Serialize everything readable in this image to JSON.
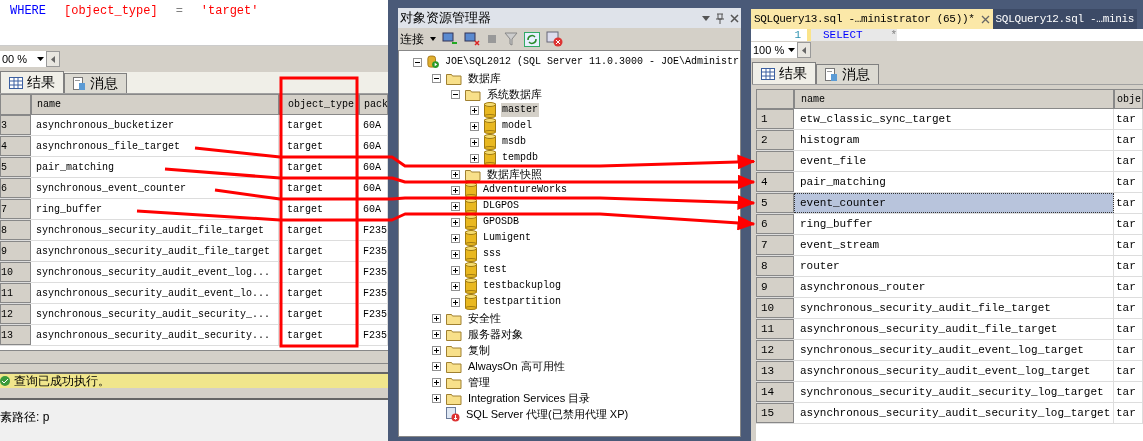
{
  "left_pane": {
    "sql_tokens": [
      {
        "kind": "keyword",
        "text": "WHERE"
      },
      {
        "kind": "identifier",
        "text": "[object_type]"
      },
      {
        "kind": "operator",
        "text": "="
      },
      {
        "kind": "string",
        "text": "'target'"
      }
    ],
    "zoom": "00 %",
    "result_tabs": [
      {
        "label": "结果",
        "selected": true
      },
      {
        "label": "消息",
        "selected": false
      }
    ],
    "columns": [
      "name",
      "object_type",
      "pack"
    ],
    "rows": [
      {
        "num": "3",
        "cells": [
          "asynchronous_bucketizer",
          "target",
          "60A"
        ]
      },
      {
        "num": "4",
        "cells": [
          "asynchronous_file_target",
          "target",
          "60A"
        ]
      },
      {
        "num": "5",
        "cells": [
          "pair_matching",
          "target",
          "60A"
        ]
      },
      {
        "num": "6",
        "cells": [
          "synchronous_event_counter",
          "target",
          "60A"
        ]
      },
      {
        "num": "7",
        "cells": [
          "ring_buffer",
          "target",
          "60A"
        ]
      },
      {
        "num": "8",
        "cells": [
          "synchronous_security_audit_file_target",
          "target",
          "F235"
        ]
      },
      {
        "num": "9",
        "cells": [
          "asynchronous_security_audit_file_target",
          "target",
          "F235"
        ]
      },
      {
        "num": "10",
        "cells": [
          "synchronous_security_audit_event_log...",
          "target",
          "F235"
        ]
      },
      {
        "num": "11",
        "cells": [
          "asynchronous_security_audit_event_lo...",
          "target",
          "F235"
        ]
      },
      {
        "num": "12",
        "cells": [
          "synchronous_security_audit_security_...",
          "target",
          "F235"
        ]
      },
      {
        "num": "13",
        "cells": [
          "asynchronous_security_audit_security...",
          "target",
          "F235"
        ]
      }
    ],
    "status": "查询已成功执行。",
    "path": "素路径: p"
  },
  "object_explorer": {
    "title": "对象资源管理器",
    "connect": "连接",
    "tree": [
      {
        "kind": "server",
        "label": "JOE\\SQL2012 (SQL Server 11.0.3000 - JOE\\Administr",
        "expanded": true,
        "selected": false,
        "children": [
          {
            "kind": "folder",
            "label": "数据库",
            "expanded": true,
            "selected": false,
            "children": [
              {
                "kind": "folder",
                "label": "系统数据库",
                "expanded": true,
                "selected": false,
                "children": [
                  {
                    "kind": "db",
                    "label": "master",
                    "selected": true
                  },
                  {
                    "kind": "db",
                    "label": "model",
                    "selected": false
                  },
                  {
                    "kind": "db",
                    "label": "msdb",
                    "selected": false
                  },
                  {
                    "kind": "db",
                    "label": "tempdb",
                    "selected": false
                  }
                ]
              },
              {
                "kind": "folder",
                "label": "数据库快照",
                "selected": false
              },
              {
                "kind": "db",
                "label": "AdventureWorks",
                "selected": false
              },
              {
                "kind": "db",
                "label": "DLGPOS",
                "selected": false
              },
              {
                "kind": "db",
                "label": "GPOSDB",
                "selected": false
              },
              {
                "kind": "db",
                "label": "Lumigent",
                "selected": false
              },
              {
                "kind": "db",
                "label": "sss",
                "selected": false
              },
              {
                "kind": "db",
                "label": "test",
                "selected": false
              },
              {
                "kind": "db",
                "label": "testbackuplog",
                "selected": false
              },
              {
                "kind": "db",
                "label": "testpartition",
                "selected": false
              }
            ]
          },
          {
            "kind": "folder",
            "label": "安全性",
            "selected": false
          },
          {
            "kind": "folder",
            "label": "服务器对象",
            "selected": false
          },
          {
            "kind": "folder",
            "label": "复制",
            "selected": false
          },
          {
            "kind": "folder",
            "label": "AlwaysOn 高可用性",
            "selected": false
          },
          {
            "kind": "folder",
            "label": "管理",
            "selected": false
          },
          {
            "kind": "folder",
            "label": "Integration Services 目录",
            "selected": false
          },
          {
            "kind": "agent",
            "label": "SQL Server 代理(已禁用代理 XP)",
            "selected": false
          }
        ]
      }
    ]
  },
  "right_pane": {
    "doc_tabs": [
      {
        "label": "SQLQuery13.sql -…ministrator (65))*",
        "selected": true
      },
      {
        "label": "SQLQuery12.sql -…minis",
        "selected": false
      }
    ],
    "line_number": "1",
    "sql_tokens": [
      {
        "kind": "keyword",
        "text": "SELECT"
      },
      {
        "kind": "operator",
        "text": "*"
      }
    ],
    "zoom": "100 %",
    "result_tabs": [
      {
        "label": "结果",
        "selected": true
      },
      {
        "label": "消息",
        "selected": false
      }
    ],
    "columns": [
      "name",
      "obje"
    ],
    "rows": [
      {
        "num": "1",
        "cells": [
          "etw_classic_sync_target",
          "tar"
        ],
        "selected": false
      },
      {
        "num": "2",
        "cells": [
          "histogram",
          "tar"
        ],
        "selected": false
      },
      {
        "num": "",
        "cells": [
          "event_file",
          "tar"
        ],
        "selected": false
      },
      {
        "num": "4",
        "cells": [
          "pair_matching",
          "tar"
        ],
        "selected": false
      },
      {
        "num": "5",
        "cells": [
          "event_counter",
          "tar"
        ],
        "selected": true
      },
      {
        "num": "6",
        "cells": [
          "ring_buffer",
          "tar"
        ],
        "selected": false
      },
      {
        "num": "7",
        "cells": [
          "event_stream",
          "tar"
        ],
        "selected": false
      },
      {
        "num": "8",
        "cells": [
          "router",
          "tar"
        ],
        "selected": false
      },
      {
        "num": "9",
        "cells": [
          "asynchronous_router",
          "tar"
        ],
        "selected": false
      },
      {
        "num": "10",
        "cells": [
          "synchronous_security_audit_file_target",
          "tar"
        ],
        "selected": false
      },
      {
        "num": "11",
        "cells": [
          "asynchronous_security_audit_file_target",
          "tar"
        ],
        "selected": false
      },
      {
        "num": "12",
        "cells": [
          "synchronous_security_audit_event_log_target",
          "tar"
        ],
        "selected": false
      },
      {
        "num": "13",
        "cells": [
          "asynchronous_security_audit_event_log_target",
          "tar"
        ],
        "selected": false
      },
      {
        "num": "14",
        "cells": [
          "synchronous_security_audit_security_log_target",
          "tar"
        ],
        "selected": false
      },
      {
        "num": "15",
        "cells": [
          "asynchronous_security_audit_security_log_target",
          "tar"
        ],
        "selected": false
      }
    ]
  }
}
